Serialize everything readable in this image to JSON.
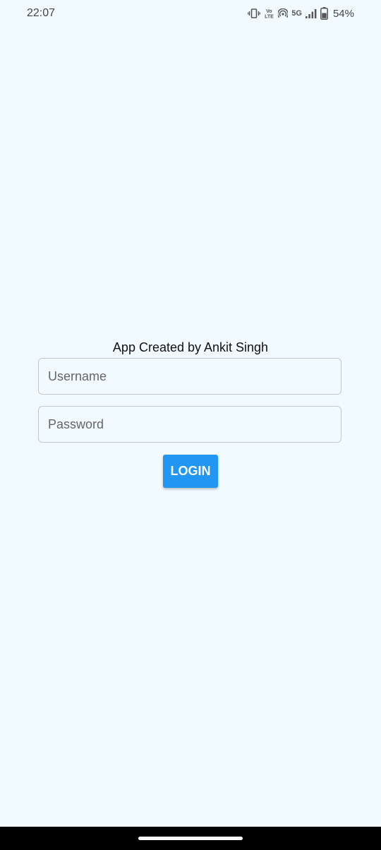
{
  "status_bar": {
    "time": "22:07",
    "network": "5G",
    "battery": "54%",
    "icons": [
      "vibrate-icon",
      "volte-icon",
      "hotspot-icon",
      "signal-icon",
      "battery-icon"
    ]
  },
  "login": {
    "credit": "App Created by Ankit Singh",
    "username_placeholder": "Username",
    "username_value": "",
    "password_placeholder": "Password",
    "password_value": "",
    "button_label": "LOGIN"
  },
  "colors": {
    "background": "#f1faff",
    "button": "#2196f3",
    "button_text": "#ffffff",
    "nav_bar": "#000000"
  }
}
